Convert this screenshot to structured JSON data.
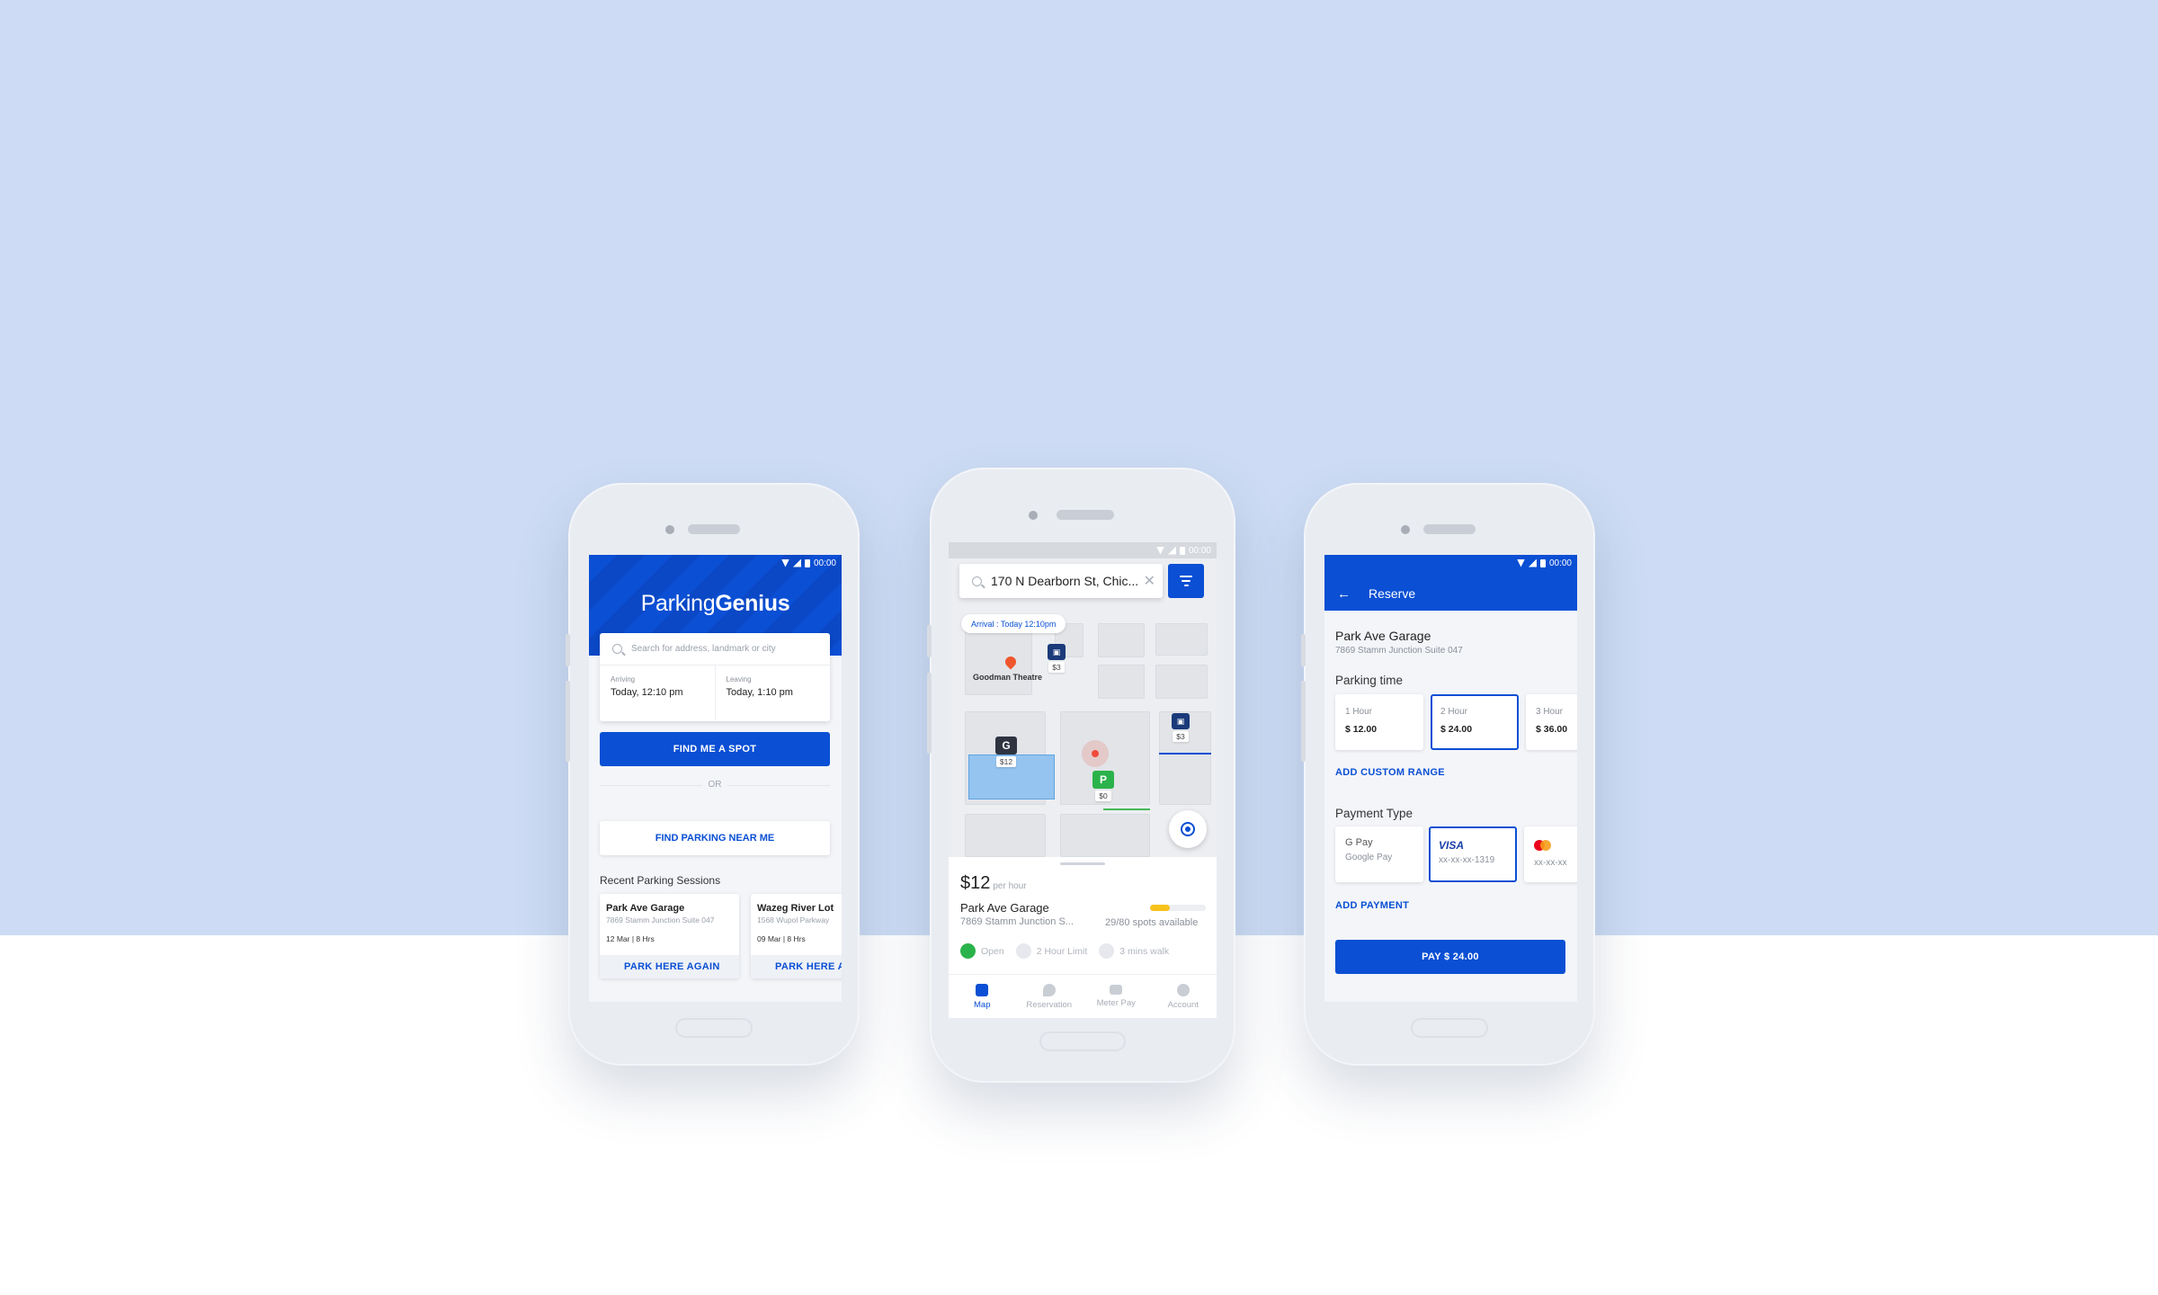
{
  "colors": {
    "brand": "#0a4fd4",
    "background": "#cddcf4",
    "open_green": "#2bb34b",
    "availability_yellow": "#f7c21c"
  },
  "status_bar": {
    "time": "00:00"
  },
  "home": {
    "logo_regular": "Parking",
    "logo_bold": "Genius",
    "search_placeholder": "Search for address, landmark or city",
    "arriving_label": "Arriving",
    "arriving_value": "Today, 12:10 pm",
    "leaving_label": "Leaving",
    "leaving_value": "Today, 1:10 pm",
    "find_spot_label": "FIND ME A SPOT",
    "or_label": "OR",
    "find_near_label": "FIND PARKING NEAR ME",
    "recent_title": "Recent Parking Sessions",
    "sessions": [
      {
        "name": "Park Ave Garage",
        "address": "7869 Stamm Junction Suite 047",
        "date": "12 Mar | 8 Hrs",
        "action": "PARK HERE AGAIN"
      },
      {
        "name": "Wazeg River Lot",
        "address": "1568 Wupol Parkway",
        "date": "09 Mar | 8 Hrs",
        "action": "PARK HERE AGAIN"
      }
    ]
  },
  "map_screen": {
    "search_value": "170 N Dearborn St, Chic...",
    "arrival_chip": "Arrival : Today 12:10pm",
    "place_label": "Goodman Theatre",
    "markers": [
      {
        "icon": "G",
        "price": "$12"
      },
      {
        "icon": "P",
        "price": "$0"
      },
      {
        "icon": "garage-icon",
        "price": "$3"
      },
      {
        "icon": "garage-icon",
        "price": "$3"
      }
    ],
    "sheet": {
      "price": "$12",
      "per": "per hour",
      "name": "Park Ave Garage",
      "address": "7869 Stamm Junction S...",
      "availability": "29/80 spots available",
      "availability_fraction": 0.36,
      "chip_open": "Open",
      "chip_limit": "2 Hour Limit",
      "chip_walk": "3 mins walk"
    },
    "nav": [
      "Map",
      "Reservation",
      "Meter Pay",
      "Account"
    ]
  },
  "reserve": {
    "title": "Reserve",
    "lot_name": "Park Ave Garage",
    "lot_address": "7869 Stamm Junction Suite 047",
    "parking_time_label": "Parking time",
    "time_options": [
      {
        "label": "1 Hour",
        "price": "$ 12.00"
      },
      {
        "label": "2 Hour",
        "price": "$ 24.00"
      },
      {
        "label": "3 Hour",
        "price": "$ 36.00"
      }
    ],
    "add_custom_range": "ADD CUSTOM RANGE",
    "payment_type_label": "Payment Type",
    "payment_options": [
      {
        "brand": "G Pay",
        "label": "Google Pay"
      },
      {
        "brand": "VISA",
        "label": "xx-xx-xx-1319"
      },
      {
        "brand": "mastercard",
        "label": "xx-xx-xx"
      }
    ],
    "add_payment": "ADD PAYMENT",
    "pay_button": "PAY $ 24.00"
  }
}
